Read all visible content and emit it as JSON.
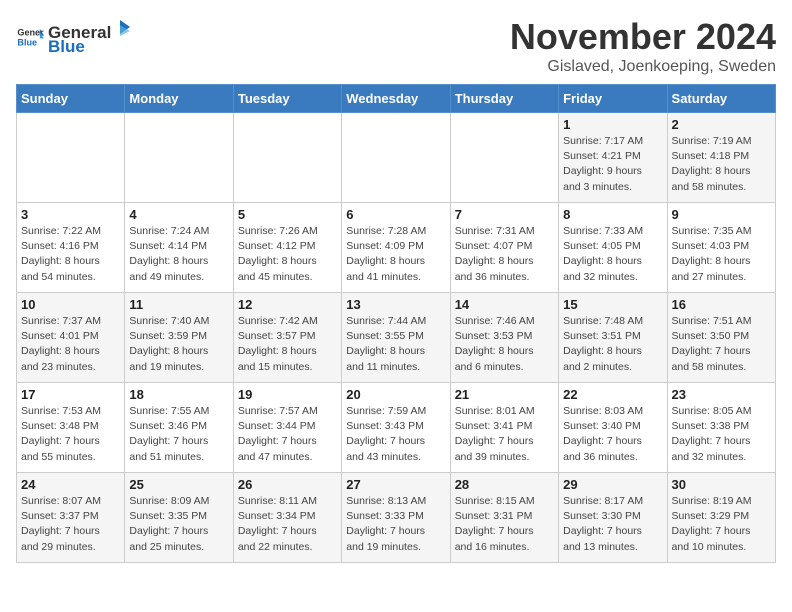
{
  "header": {
    "logo_general": "General",
    "logo_blue": "Blue",
    "title": "November 2024",
    "subtitle": "Gislaved, Joenkoeping, Sweden"
  },
  "days_of_week": [
    "Sunday",
    "Monday",
    "Tuesday",
    "Wednesday",
    "Thursday",
    "Friday",
    "Saturday"
  ],
  "weeks": [
    [
      {
        "day": "",
        "info": ""
      },
      {
        "day": "",
        "info": ""
      },
      {
        "day": "",
        "info": ""
      },
      {
        "day": "",
        "info": ""
      },
      {
        "day": "",
        "info": ""
      },
      {
        "day": "1",
        "info": "Sunrise: 7:17 AM\nSunset: 4:21 PM\nDaylight: 9 hours\nand 3 minutes."
      },
      {
        "day": "2",
        "info": "Sunrise: 7:19 AM\nSunset: 4:18 PM\nDaylight: 8 hours\nand 58 minutes."
      }
    ],
    [
      {
        "day": "3",
        "info": "Sunrise: 7:22 AM\nSunset: 4:16 PM\nDaylight: 8 hours\nand 54 minutes."
      },
      {
        "day": "4",
        "info": "Sunrise: 7:24 AM\nSunset: 4:14 PM\nDaylight: 8 hours\nand 49 minutes."
      },
      {
        "day": "5",
        "info": "Sunrise: 7:26 AM\nSunset: 4:12 PM\nDaylight: 8 hours\nand 45 minutes."
      },
      {
        "day": "6",
        "info": "Sunrise: 7:28 AM\nSunset: 4:09 PM\nDaylight: 8 hours\nand 41 minutes."
      },
      {
        "day": "7",
        "info": "Sunrise: 7:31 AM\nSunset: 4:07 PM\nDaylight: 8 hours\nand 36 minutes."
      },
      {
        "day": "8",
        "info": "Sunrise: 7:33 AM\nSunset: 4:05 PM\nDaylight: 8 hours\nand 32 minutes."
      },
      {
        "day": "9",
        "info": "Sunrise: 7:35 AM\nSunset: 4:03 PM\nDaylight: 8 hours\nand 27 minutes."
      }
    ],
    [
      {
        "day": "10",
        "info": "Sunrise: 7:37 AM\nSunset: 4:01 PM\nDaylight: 8 hours\nand 23 minutes."
      },
      {
        "day": "11",
        "info": "Sunrise: 7:40 AM\nSunset: 3:59 PM\nDaylight: 8 hours\nand 19 minutes."
      },
      {
        "day": "12",
        "info": "Sunrise: 7:42 AM\nSunset: 3:57 PM\nDaylight: 8 hours\nand 15 minutes."
      },
      {
        "day": "13",
        "info": "Sunrise: 7:44 AM\nSunset: 3:55 PM\nDaylight: 8 hours\nand 11 minutes."
      },
      {
        "day": "14",
        "info": "Sunrise: 7:46 AM\nSunset: 3:53 PM\nDaylight: 8 hours\nand 6 minutes."
      },
      {
        "day": "15",
        "info": "Sunrise: 7:48 AM\nSunset: 3:51 PM\nDaylight: 8 hours\nand 2 minutes."
      },
      {
        "day": "16",
        "info": "Sunrise: 7:51 AM\nSunset: 3:50 PM\nDaylight: 7 hours\nand 58 minutes."
      }
    ],
    [
      {
        "day": "17",
        "info": "Sunrise: 7:53 AM\nSunset: 3:48 PM\nDaylight: 7 hours\nand 55 minutes."
      },
      {
        "day": "18",
        "info": "Sunrise: 7:55 AM\nSunset: 3:46 PM\nDaylight: 7 hours\nand 51 minutes."
      },
      {
        "day": "19",
        "info": "Sunrise: 7:57 AM\nSunset: 3:44 PM\nDaylight: 7 hours\nand 47 minutes."
      },
      {
        "day": "20",
        "info": "Sunrise: 7:59 AM\nSunset: 3:43 PM\nDaylight: 7 hours\nand 43 minutes."
      },
      {
        "day": "21",
        "info": "Sunrise: 8:01 AM\nSunset: 3:41 PM\nDaylight: 7 hours\nand 39 minutes."
      },
      {
        "day": "22",
        "info": "Sunrise: 8:03 AM\nSunset: 3:40 PM\nDaylight: 7 hours\nand 36 minutes."
      },
      {
        "day": "23",
        "info": "Sunrise: 8:05 AM\nSunset: 3:38 PM\nDaylight: 7 hours\nand 32 minutes."
      }
    ],
    [
      {
        "day": "24",
        "info": "Sunrise: 8:07 AM\nSunset: 3:37 PM\nDaylight: 7 hours\nand 29 minutes."
      },
      {
        "day": "25",
        "info": "Sunrise: 8:09 AM\nSunset: 3:35 PM\nDaylight: 7 hours\nand 25 minutes."
      },
      {
        "day": "26",
        "info": "Sunrise: 8:11 AM\nSunset: 3:34 PM\nDaylight: 7 hours\nand 22 minutes."
      },
      {
        "day": "27",
        "info": "Sunrise: 8:13 AM\nSunset: 3:33 PM\nDaylight: 7 hours\nand 19 minutes."
      },
      {
        "day": "28",
        "info": "Sunrise: 8:15 AM\nSunset: 3:31 PM\nDaylight: 7 hours\nand 16 minutes."
      },
      {
        "day": "29",
        "info": "Sunrise: 8:17 AM\nSunset: 3:30 PM\nDaylight: 7 hours\nand 13 minutes."
      },
      {
        "day": "30",
        "info": "Sunrise: 8:19 AM\nSunset: 3:29 PM\nDaylight: 7 hours\nand 10 minutes."
      }
    ]
  ]
}
